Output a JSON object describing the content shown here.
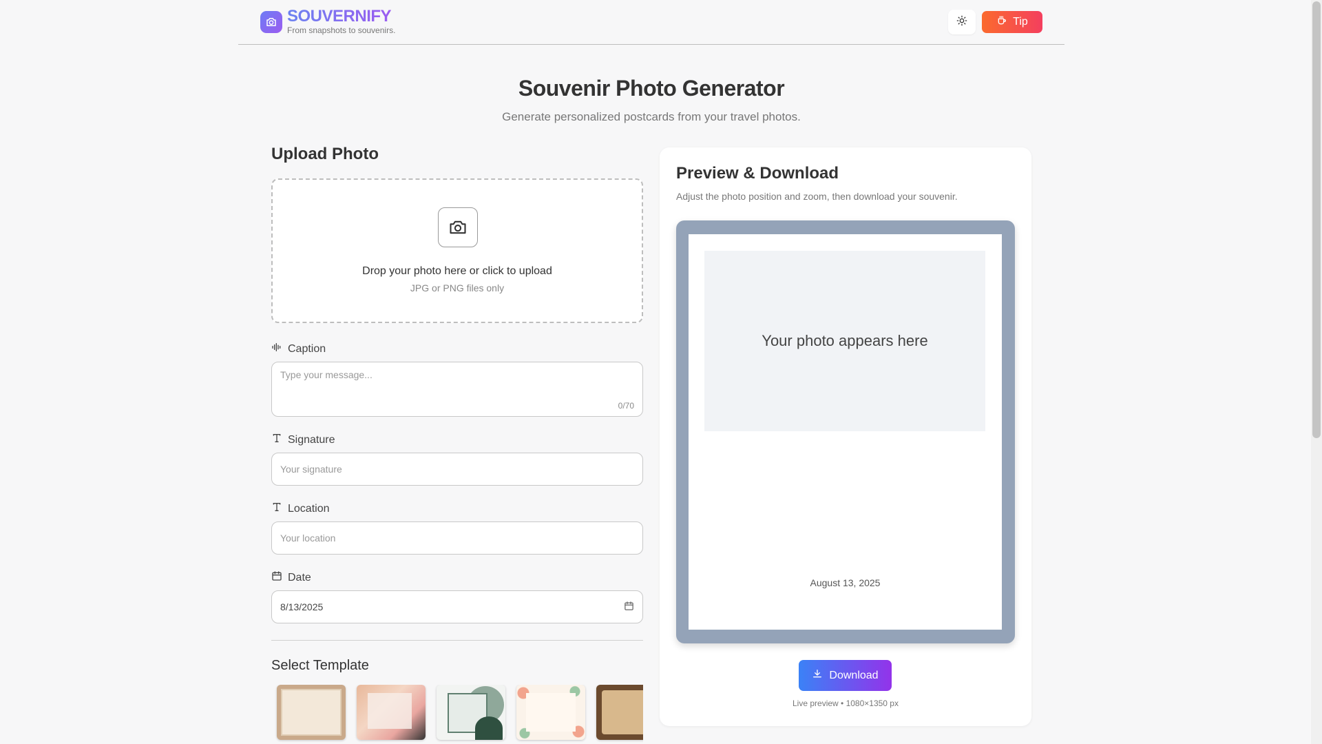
{
  "header": {
    "brand": "SOUVERNIFY",
    "tagline": "From snapshots to souvenirs.",
    "tip_label": "Tip",
    "icons": {
      "logo": "camera-icon",
      "theme": "sun-icon",
      "tip": "coffee-cup-icon"
    }
  },
  "hero": {
    "title": "Souvenir Photo Generator",
    "subtitle": "Generate personalized postcards from your travel photos."
  },
  "upload": {
    "heading": "Upload Photo",
    "title": "Drop your photo here or click to upload",
    "hint": "JPG or PNG files only"
  },
  "form": {
    "caption": {
      "label": "Caption",
      "placeholder": "Type your message...",
      "count": "0/70"
    },
    "signature": {
      "label": "Signature",
      "placeholder": "Your signature"
    },
    "location": {
      "label": "Location",
      "placeholder": "Your location"
    },
    "date": {
      "label": "Date",
      "value": "8/13/2025"
    }
  },
  "templates": {
    "heading": "Select Template",
    "items": [
      "classic-frame",
      "watercolor-abstract",
      "tropical-leaves",
      "floral-border",
      "vintage-paper"
    ]
  },
  "preview": {
    "title": "Preview & Download",
    "description": "Adjust the photo position and zoom, then download your souvenir.",
    "photo_placeholder": "Your photo appears here",
    "date_text": "August 13, 2025",
    "download_label": "Download",
    "meta": "Live preview • 1080×1350 px"
  },
  "colors": {
    "accent_start": "#3b82f6",
    "accent_end": "#9333ea",
    "tip_start": "#fb6a2e",
    "tip_end": "#f43f5e",
    "frame": "#94a3b8"
  }
}
